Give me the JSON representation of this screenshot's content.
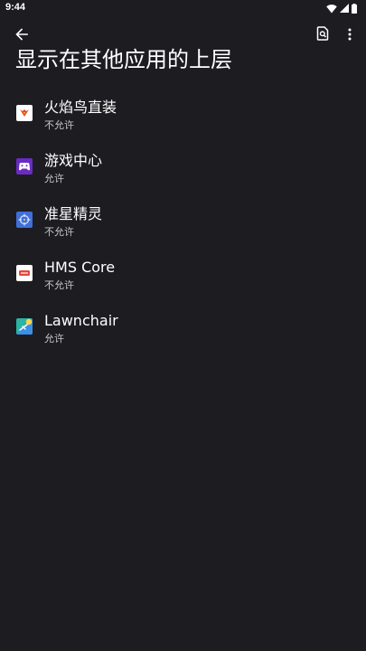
{
  "status_bar": {
    "time": "9:44",
    "icons": [
      "wifi-icon",
      "signal-icon",
      "battery-icon"
    ]
  },
  "app_bar": {
    "back_icon": "arrow-back-icon",
    "search_icon": "search-in-page-icon",
    "more_icon": "more-vert-icon"
  },
  "page": {
    "title": "显示在其他应用的上层"
  },
  "apps": [
    {
      "name": "火焰鸟直装",
      "status": "不允许",
      "icon": "firebird-app-icon"
    },
    {
      "name": "游戏中心",
      "status": "允许",
      "icon": "game-center-icon"
    },
    {
      "name": "准星精灵",
      "status": "不允许",
      "icon": "crosshair-sprite-icon"
    },
    {
      "name": "HMS Core",
      "status": "不允许",
      "icon": "hms-core-icon"
    },
    {
      "name": "Lawnchair",
      "status": "允许",
      "icon": "lawnchair-icon"
    }
  ],
  "colors": {
    "background": "#1d1c21",
    "text_primary": "#ffffff",
    "text_secondary": "#c8c6cc"
  }
}
